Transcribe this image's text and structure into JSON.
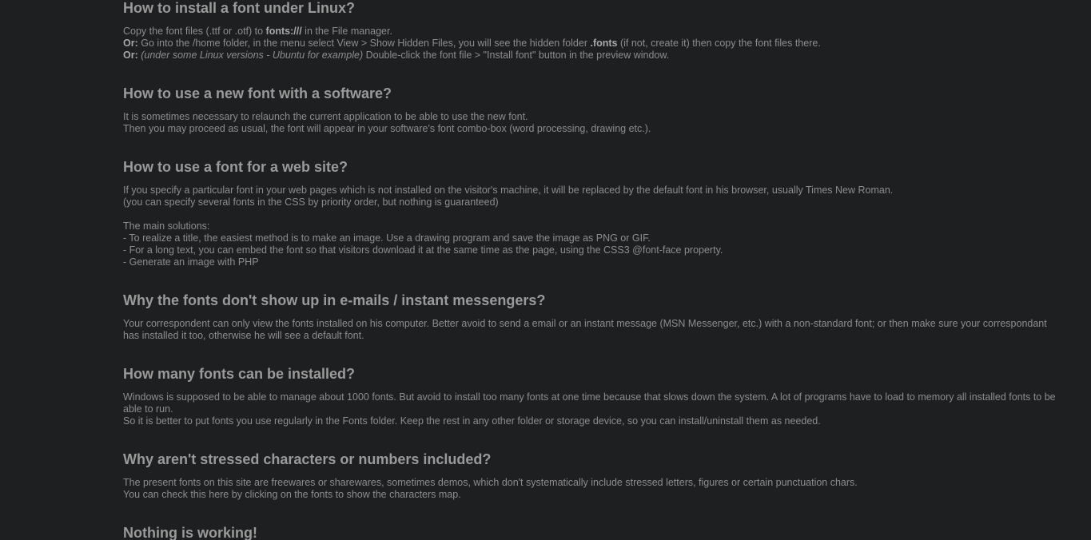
{
  "sections": [
    {
      "title": "How to install a font under Linux?",
      "lines": [
        {
          "a": "Copy the font files (.ttf or .otf) to ",
          "b": "fonts:///",
          "c": " in the File manager."
        },
        {
          "lead": "Or:",
          "a": " Go into the /home folder, in the menu select View > Show Hidden Files, you will see the hidden folder ",
          "b": ".fonts",
          "c": " (if not, create it) then copy the font files there."
        },
        {
          "lead": "Or:",
          "it": "(under some Linux versions - Ubuntu for example)",
          "c": " Double-click the font file > \"Install font\" button in the preview window."
        }
      ]
    },
    {
      "title": "How to use a new font with a software?",
      "lines": [
        "It is sometimes necessary to relaunch the current application to be able to use the new font.",
        "Then you may proceed as usual, the font will appear in your software's font combo-box (word processing, drawing etc.)."
      ]
    },
    {
      "title": "How to use a font for a web site?",
      "lines": [
        "If you specify a particular font in your web pages which is not installed on the visitor's machine, it will be replaced by the default font in his browser, usually Times New Roman.",
        "(you can specify several fonts in the CSS by priority order, but nothing is guaranteed)",
        "",
        "The main solutions:",
        "- To realize a title, the easiest method is to make an image. Use a drawing program and save the image as PNG or GIF.",
        "- For a long text, you can embed the font so that visitors download it at the same time as the page, using the CSS3 @font-face property.",
        "- Generate an image with PHP"
      ]
    },
    {
      "title": "Why the fonts don't show up in e-mails / instant messengers?",
      "lines": [
        "Your correspondent can only view the fonts installed on his computer. Better avoid to send a email or an instant message (MSN Messenger, etc.) with a non-standard font; or then make sure your correspondant has installed it too, otherwise he will see a default font."
      ]
    },
    {
      "title": "How many fonts can be installed?",
      "lines": [
        "Windows is supposed to be able to manage about 1000 fonts. But avoid to install too many fonts at one time because that slows down the system. A lot of programs have to load to memory all installed fonts to be able to run.",
        "So it is better to put fonts you use regularly in the Fonts folder. Keep the rest in any other folder or storage device, so you can install/uninstall them as needed."
      ]
    },
    {
      "title": "Why aren't stressed characters or numbers included?",
      "lines": [
        "The present fonts on this site are freewares or sharewares, sometimes demos, which don't systematically include stressed letters, figures or certain punctuation chars.",
        "You can check this here by clicking on the fonts to show the characters map."
      ]
    },
    {
      "title": "Nothing is working!",
      "lines": []
    }
  ]
}
